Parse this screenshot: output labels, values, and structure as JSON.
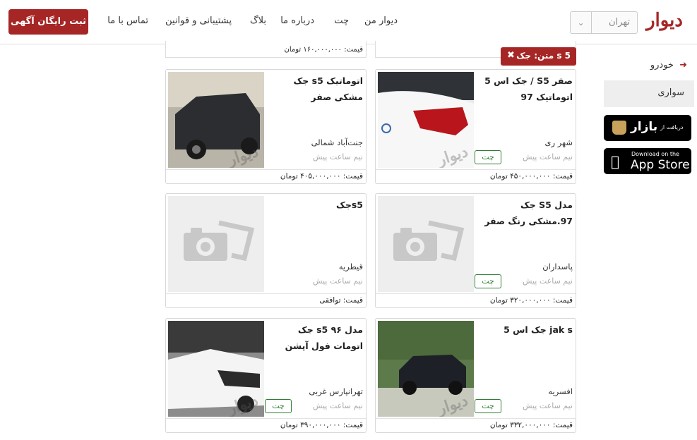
{
  "header": {
    "logo": "دیوار",
    "city": "تهران",
    "nav": [
      "دیوار من",
      "چت",
      "درباره ما",
      "بلاگ",
      "پشتیبانی و قوانین",
      "تماس با ما"
    ],
    "cta": "ثبت رایگان آگهی"
  },
  "sidebar": {
    "category": "خودرو",
    "subcategory": "سواری",
    "bazaar_small": "دریافت از",
    "bazaar_big": "بازار",
    "appstore_small": "Download on the",
    "appstore_big": "App Store"
  },
  "filter_tag": "متن: جک s 5",
  "partial_price": "قیمت: ۱۶۰,۰۰۰,۰۰۰ تومان",
  "watermark": "دیوار",
  "chat_label": "چت",
  "cards": [
    {
      "title": "جک اس 5 / S5 صفر اتوماتیک 97",
      "location": "شهر ری",
      "time": "نیم ساعت پیش",
      "price": "قیمت: ۴۵۰,۰۰۰,۰۰۰ تومان",
      "chat": true,
      "photo": "white-rear"
    },
    {
      "title": "جک s5 اتوماتیک مشکی صفر",
      "location": "جنت‌آباد شمالی",
      "time": "نیم ساعت پیش",
      "price": "قیمت: ۴۰۵,۰۰۰,۰۰۰ تومان",
      "chat": false,
      "photo": "dark-garage"
    },
    {
      "title": "جک S5 مدل 97.مشکی رنگ صفر",
      "location": "پاسداران",
      "time": "نیم ساعت پیش",
      "price": "قیمت: ۳۲۰,۰۰۰,۰۰۰ تومان",
      "chat": true,
      "photo": "placeholder"
    },
    {
      "title": "جکs5",
      "location": "قیطریه",
      "time": "نیم ساعت پیش",
      "price": "قیمت: توافقی",
      "chat": false,
      "photo": "placeholder"
    },
    {
      "title": "جک اس 5 jak s",
      "location": "افسریه",
      "time": "نیم ساعت پیش",
      "price": "قیمت: ۳۳۲,۰۰۰,۰۰۰ تومان",
      "chat": true,
      "photo": "outdoor"
    },
    {
      "title": "جک s5 مدل ۹۶ اتومات فول آپشن",
      "location": "تهرانپارس غربی",
      "time": "نیم ساعت پیش",
      "price": "قیمت: ۳۹۰,۰۰۰,۰۰۰ تومان",
      "chat": true,
      "photo": "white-garage"
    }
  ]
}
